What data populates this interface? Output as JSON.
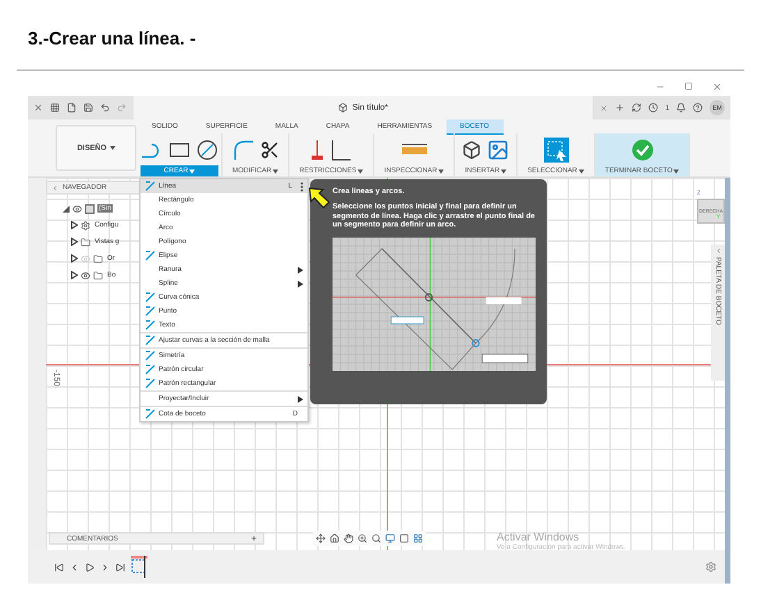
{
  "heading": "3.-Crear una línea. -",
  "document_tab": {
    "title": "Sin título*"
  },
  "job_count": "1",
  "user_initials": "EM",
  "workspace": {
    "label": "DISEÑO"
  },
  "ribbon_tabs": [
    {
      "label": "SOLIDO",
      "selected": false
    },
    {
      "label": "SUPERFICIE",
      "selected": false
    },
    {
      "label": "MALLA",
      "selected": false
    },
    {
      "label": "CHAPA",
      "selected": false
    },
    {
      "label": "HERRAMIENTAS",
      "selected": false
    },
    {
      "label": "BOCETO",
      "selected": true
    }
  ],
  "tool_groups": [
    {
      "label": "CREAR",
      "kind": "tools",
      "selected": true
    },
    {
      "label": "MODIFICAR",
      "kind": "tools",
      "selected": false
    },
    {
      "label": "RESTRICCIONES",
      "kind": "tools",
      "selected": false
    },
    {
      "label": "INSPECCIONAR",
      "kind": "tools",
      "selected": false
    },
    {
      "label": "INSERTAR",
      "kind": "tools",
      "selected": false
    },
    {
      "label": "SELECCIONAR",
      "kind": "tools",
      "selected": false
    },
    {
      "label": "TERMINAR BOCETO",
      "kind": "finish",
      "selected": false
    }
  ],
  "navigator": {
    "title": "NAVEGADOR",
    "root": {
      "label": "(Sin",
      "kind": "component",
      "visible": true,
      "selected": true,
      "children": [
        {
          "label": "Configu",
          "kind": "settings",
          "selected": false
        },
        {
          "label": "Vistas g",
          "kind": "folder",
          "selected": false
        },
        {
          "label": "Or",
          "kind": "folder",
          "visible": false,
          "selected": false
        },
        {
          "label": "Bo",
          "kind": "folder",
          "visible": true,
          "selected": false
        }
      ]
    }
  },
  "create_menu": {
    "sections": [
      [
        {
          "label": "Línea",
          "kind": "icon",
          "shortcut": "L",
          "submenu": false,
          "selected": true
        },
        {
          "label": "Rectángulo",
          "kind": "plain",
          "submenu": false,
          "selected": false
        },
        {
          "label": "Círculo",
          "kind": "plain",
          "submenu": false,
          "selected": false
        },
        {
          "label": "Arco",
          "kind": "plain",
          "submenu": false,
          "selected": false
        },
        {
          "label": "Polígono",
          "kind": "plain",
          "submenu": false,
          "selected": false
        },
        {
          "label": "Elipse",
          "kind": "icon",
          "submenu": false,
          "selected": false
        },
        {
          "label": "Ranura",
          "kind": "plain",
          "submenu": true,
          "selected": false
        },
        {
          "label": "Spline",
          "kind": "plain",
          "submenu": true,
          "selected": false
        },
        {
          "label": "Curva cónica",
          "kind": "icon",
          "submenu": false,
          "selected": false
        },
        {
          "label": "Punto",
          "kind": "icon",
          "submenu": false,
          "selected": false
        },
        {
          "label": "Texto",
          "kind": "icon",
          "submenu": false,
          "selected": false
        }
      ],
      [
        {
          "label": "Ajustar curvas a la sección de malla",
          "kind": "icon",
          "submenu": false,
          "selected": false
        }
      ],
      [
        {
          "label": "Simetría",
          "kind": "icon",
          "submenu": false,
          "selected": false
        },
        {
          "label": "Patrón circular",
          "kind": "icon",
          "submenu": false,
          "selected": false
        },
        {
          "label": "Patrón rectangular",
          "kind": "icon",
          "submenu": false,
          "selected": false
        }
      ],
      [
        {
          "label": "Proyectar/Incluir",
          "kind": "plain",
          "submenu": true,
          "selected": false
        }
      ],
      [
        {
          "label": "Cota de boceto",
          "kind": "icon",
          "shortcut": "D",
          "submenu": false,
          "selected": false
        }
      ]
    ]
  },
  "tooltip": {
    "title": "Crea líneas y arcos.",
    "body": "Seleccione los puntos inicial y final para definir un segmento de línea. Haga clic y arrastre el punto final de un segmento para definir un arco."
  },
  "view_cube": {
    "face": "DERECHA",
    "z_label": "Z",
    "y_label": "Y"
  },
  "sketch_palette": {
    "title": "PALETA DE BOCETO"
  },
  "axis_label": "-150",
  "comments": {
    "title": "COMENTARIOS"
  },
  "activation_notice": {
    "title": "Activar Windows",
    "text": "Ve a Configuración para activar Windows."
  }
}
